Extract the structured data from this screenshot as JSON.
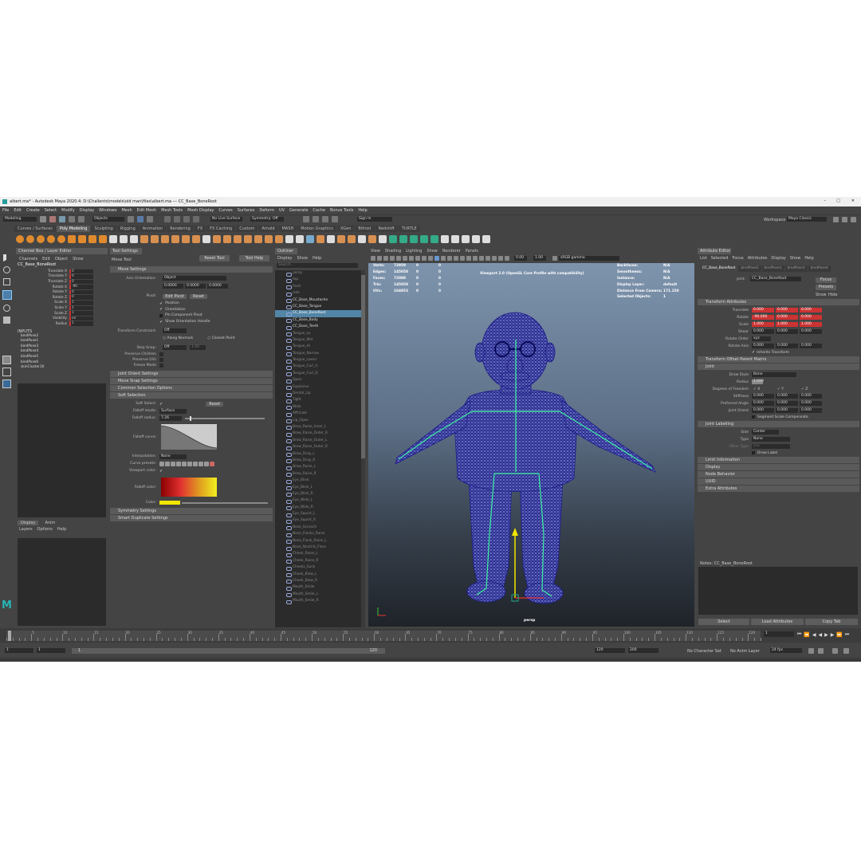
{
  "titlebar": {
    "title": "albert.ma* - Autodesk Maya 2020.4: D:\\Challento\\models\\old man\\files\\albert.ma  ---  CC_Base_BoneRoot"
  },
  "menubar": [
    "File",
    "Edit",
    "Create",
    "Select",
    "Modify",
    "Display",
    "Windows",
    "Mesh",
    "Edit Mesh",
    "Mesh Tools",
    "Mesh Display",
    "Curves",
    "Surfaces",
    "Deform",
    "UV",
    "Generate",
    "Cache",
    "Bonus Tools",
    "Help"
  ],
  "statusline": {
    "mode": "Modeling",
    "objects": "Objects",
    "live_surface": "No Live Surface",
    "symmetry": "Symmetry: Off",
    "sign_in": "Sign In",
    "workspace_label": "Workspace :",
    "workspace": "Maya Classic"
  },
  "shelf_tabs": [
    "Curves / Surfaces",
    "Poly Modeling",
    "Sculpting",
    "Rigging",
    "Animation",
    "Rendering",
    "FX",
    "FX Caching",
    "Custom",
    "Arnold",
    "MASH",
    "Motion Graphics",
    "XGen",
    "Bifrost",
    "Redshift",
    "TURTLE"
  ],
  "channel_box": {
    "tabs": "Channel Box / Layer Editor",
    "menu": [
      "Channels",
      "Edit",
      "Object",
      "Show"
    ],
    "object": "CC_Base_BoneRoot",
    "attrs": [
      {
        "name": "Translate X",
        "value": "0"
      },
      {
        "name": "Translate Y",
        "value": "0"
      },
      {
        "name": "Translate Z",
        "value": "0"
      },
      {
        "name": "Rotate X",
        "value": "-90"
      },
      {
        "name": "Rotate Y",
        "value": "0"
      },
      {
        "name": "Rotate Z",
        "value": "0"
      },
      {
        "name": "Scale X",
        "value": "1"
      },
      {
        "name": "Scale Y",
        "value": "1"
      },
      {
        "name": "Scale Z",
        "value": "1"
      },
      {
        "name": "Visibility",
        "value": "on"
      },
      {
        "name": "Radius",
        "value": "1"
      }
    ],
    "outputs_label": "INPUTS",
    "outputs": [
      "bindPose2",
      "bindPose1",
      "bindPose3",
      "bindPose4",
      "bindPose5",
      "bindPose6",
      "skinCluster16"
    ]
  },
  "layer_editor": {
    "tabs": [
      "Display",
      "Anim"
    ],
    "menu": [
      "Layers",
      "Options",
      "Help"
    ]
  },
  "tool_settings": {
    "title": "Tool Settings",
    "tool": "Move Tool",
    "reset": "Reset Tool",
    "help": "Tool Help",
    "move_settings": "Move Settings",
    "axis_orientation_label": "Axis Orientation:",
    "axis_orientation": "Object",
    "xyz": [
      "0.0000",
      "0.0000",
      "0.0000"
    ],
    "pivot_label": "Pivot:",
    "edit_pivot": "Edit Pivot",
    "reset_btn": "Reset",
    "checks": [
      "Position",
      "Orientation",
      "Pin Component Pivot",
      "Show Orientation Handle"
    ],
    "transform_constraint_label": "Transform Constraint:",
    "transform_constraint": "Off",
    "along_normals": "Along Normals",
    "closest_point": "Closest Point",
    "step_snap_label": "Step Snap:",
    "step_snap": "Off",
    "step_value": "1.00",
    "preserve": [
      "Preserve Children",
      "Preserve UVs",
      "Freeze Mode"
    ],
    "sections": [
      "Joint Orient Settings",
      "Move Snap Settings",
      "Common Selection Options",
      "Soft Selection"
    ],
    "soft_select_label": "Soft Select:",
    "falloff_mode_label": "Falloff mode:",
    "falloff_mode": "Surface",
    "falloff_radius_label": "Falloff radius:",
    "falloff_radius": "7.26",
    "falloff_curve_label": "Falloff curve:",
    "interpolation_label": "Interpolation:",
    "interpolation": "None",
    "curve_presets_label": "Curve presets:",
    "viewport_color_label": "Viewport color:",
    "falloff_color_label": "Falloff color:",
    "color_label": "Color:",
    "bottom_sections": [
      "Symmetry Settings",
      "Smart Duplicate Settings"
    ]
  },
  "outliner": {
    "title": "Outliner",
    "menu": [
      "Display",
      "Show",
      "Help"
    ],
    "search": "Search...",
    "items": [
      {
        "name": "persp",
        "state": "dim"
      },
      {
        "name": "top",
        "state": "dim"
      },
      {
        "name": "front",
        "state": "dim"
      },
      {
        "name": "side",
        "state": "dim"
      },
      {
        "name": "CC_Base_Moustache",
        "state": "bright"
      },
      {
        "name": "CC_Base_Tongue",
        "state": "bright"
      },
      {
        "name": "CC_Base_BoneRoot",
        "state": "sel"
      },
      {
        "name": "CC_Base_Body",
        "state": "bright"
      },
      {
        "name": "CC_Base_Teeth",
        "state": "bright"
      },
      {
        "name": "Tongue_Lo",
        "state": "dim"
      },
      {
        "name": "Tongue_Mid",
        "state": "dim"
      },
      {
        "name": "Tongue_Hi",
        "state": "dim"
      },
      {
        "name": "Tongue_Narrow",
        "state": "dim"
      },
      {
        "name": "Tongue_Lower",
        "state": "dim"
      },
      {
        "name": "Tongue_Curl_U",
        "state": "dim"
      },
      {
        "name": "Tongue_Curl_D",
        "state": "dim"
      },
      {
        "name": "Open",
        "state": "dim"
      },
      {
        "name": "Explosive",
        "state": "dim"
      },
      {
        "name": "Dental_Lip",
        "state": "dim"
      },
      {
        "name": "Tight",
        "state": "dim"
      },
      {
        "name": "Wide",
        "state": "dim"
      },
      {
        "name": "Affricate",
        "state": "dim"
      },
      {
        "name": "Lip_Open",
        "state": "dim"
      },
      {
        "name": "Brow_Raise_Inner_L",
        "state": "dim"
      },
      {
        "name": "Brow_Raise_Outer_R",
        "state": "dim"
      },
      {
        "name": "Brow_Raise_Outer_L",
        "state": "dim"
      },
      {
        "name": "Brow_Raise_Outer_R",
        "state": "dim"
      },
      {
        "name": "Brow_Drop_L",
        "state": "dim"
      },
      {
        "name": "Brow_Drop_R",
        "state": "dim"
      },
      {
        "name": "Brow_Raise_L",
        "state": "dim"
      },
      {
        "name": "Brow_Raise_R",
        "state": "dim"
      },
      {
        "name": "Eye_Blink",
        "state": "dim"
      },
      {
        "name": "Eye_Blink_L",
        "state": "dim"
      },
      {
        "name": "Eye_Blink_R",
        "state": "dim"
      },
      {
        "name": "Eye_Wide_L",
        "state": "dim"
      },
      {
        "name": "Eye_Wide_R",
        "state": "dim"
      },
      {
        "name": "Eye_Squint_L",
        "state": "dim"
      },
      {
        "name": "Eye_Squint_R",
        "state": "dim"
      },
      {
        "name": "Nose_Scrunch",
        "state": "dim"
      },
      {
        "name": "Nose_Flanks_Raise",
        "state": "dim"
      },
      {
        "name": "Nose_Flank_Raise_L",
        "state": "dim"
      },
      {
        "name": "Nose_Nostrils_Flare",
        "state": "dim"
      },
      {
        "name": "Cheek_Raise_L",
        "state": "dim"
      },
      {
        "name": "Cheek_Raise_R",
        "state": "dim"
      },
      {
        "name": "Cheeks_Suck",
        "state": "dim"
      },
      {
        "name": "Cheek_Blow_L",
        "state": "dim"
      },
      {
        "name": "Cheek_Blow_R",
        "state": "dim"
      },
      {
        "name": "Mouth_Smile",
        "state": "dim"
      },
      {
        "name": "Mouth_Smile_L",
        "state": "dim"
      },
      {
        "name": "Mouth_Smile_R",
        "state": "dim"
      }
    ]
  },
  "viewport": {
    "menu": [
      "View",
      "Shading",
      "Lighting",
      "Show",
      "Renderer",
      "Panels"
    ],
    "exposure": "0.00",
    "gamma": "1.00",
    "colorspace": "sRGB gamma",
    "hud_left": [
      {
        "label": "Verts:",
        "a": "72959",
        "b": "0",
        "c": "0"
      },
      {
        "label": "Edges:",
        "a": "145058",
        "b": "0",
        "c": "0"
      },
      {
        "label": "Faces:",
        "a": "72088",
        "b": "0",
        "c": "0"
      },
      {
        "label": "Tris:",
        "a": "145058",
        "b": "0",
        "c": "0"
      },
      {
        "label": "UVs:",
        "a": "104853",
        "b": "0",
        "c": "0"
      }
    ],
    "hud_center": "Viewport 2.0 (OpenGL Core Profile with compatibility)",
    "hud_right": [
      {
        "label": "Backfaces:",
        "value": "N/A"
      },
      {
        "label": "Smoothness:",
        "value": "N/A"
      },
      {
        "label": "Instance:",
        "value": "N/A"
      },
      {
        "label": "Display Layer:",
        "value": "default"
      },
      {
        "label": "Distance From Camera:",
        "value": "171.150"
      },
      {
        "label": "Selected Objects:",
        "value": "1"
      }
    ],
    "camera": "persp"
  },
  "attribute_editor": {
    "title": "Attribute Editor",
    "menu": [
      "List",
      "Selected",
      "Focus",
      "Attributes",
      "Display",
      "Show",
      "Help"
    ],
    "tabs": [
      "CC_Base_BoneRoot",
      "bindPose2",
      "bindPose1",
      "bindPose3",
      "bindPose4"
    ],
    "joint_label": "joint:",
    "joint": "CC_Base_BoneRoot",
    "focus": "Focus",
    "presets": "Presets",
    "show": "Show",
    "hide": "Hide",
    "transform_section": "Transform Attributes",
    "translate_label": "Translate",
    "translate": [
      "0.000",
      "0.000",
      "0.000"
    ],
    "rotate_label": "Rotate",
    "rotate": [
      "-90.000",
      "0.000",
      "0.000"
    ],
    "scale_label": "Scale",
    "scale": [
      "1.000",
      "1.000",
      "1.000"
    ],
    "shear_label": "Shear",
    "shear": [
      "0.000",
      "0.000",
      "0.000"
    ],
    "rotate_order_label": "Rotate Order",
    "rotate_order": "xyz",
    "rotate_axis_label": "Rotate Axis",
    "rotate_axis": [
      "0.000",
      "0.000",
      "0.000"
    ],
    "inherits": "Inherits Transform",
    "offset_section": "Transform Offset Parent Matrix",
    "joint_section": "Joint",
    "draw_style_label": "Draw Style",
    "draw_style": "Bone",
    "radius_label": "Radius",
    "radius": "1.000",
    "dof_label": "Degrees of Freedom",
    "dof": [
      "X",
      "Y",
      "Z"
    ],
    "stiffness_label": "Stiffness",
    "stiffness": [
      "0.000",
      "0.000",
      "0.000"
    ],
    "preferred_label": "Preferred Angle",
    "preferred": [
      "0.000",
      "0.000",
      "0.000"
    ],
    "joint_orient_label": "Joint Orient",
    "joint_orient": [
      "0.000",
      "0.000",
      "0.000"
    ],
    "segment_scale": "Segment Scale Compensate",
    "labelling_section": "Joint Labelling",
    "side_label": "Side",
    "side": "Center",
    "type_label": "Type",
    "type": "None",
    "other_type_label": "Other Type",
    "other_type": "Jaw",
    "draw_label": "Draw Label",
    "collapsed": [
      "Limit Information",
      "Display",
      "Node Behavior",
      "UUID",
      "Extra Attributes"
    ],
    "notes_label": "Notes: CC_Base_BoneRoot",
    "buttons": [
      "Select",
      "Load Attributes",
      "Copy Tab"
    ]
  },
  "timeslider": {
    "ticks": [
      "5",
      "10",
      "15",
      "20",
      "25",
      "30",
      "35",
      "40",
      "45",
      "50",
      "55",
      "60",
      "65",
      "70",
      "75",
      "80",
      "85",
      "90",
      "95",
      "100",
      "105",
      "110",
      "115",
      "120"
    ],
    "current_frame": "1"
  },
  "rangeslider": {
    "start": "1",
    "start2": "1",
    "range_mid": "1",
    "range_end": "120",
    "end": "120",
    "end2": "200",
    "character_set": "No Character Set",
    "anim_layer": "No Anim Layer",
    "fps": "24 fps"
  },
  "colors": {
    "accent_selected": "#5285a6",
    "red_field": "#cc3333",
    "viewport_top": "#7e94ad",
    "viewport_bottom": "#1f2329",
    "mesh": "#2a2a8c",
    "skeleton": "#3cf2a0",
    "yellow": "#f2e600"
  }
}
